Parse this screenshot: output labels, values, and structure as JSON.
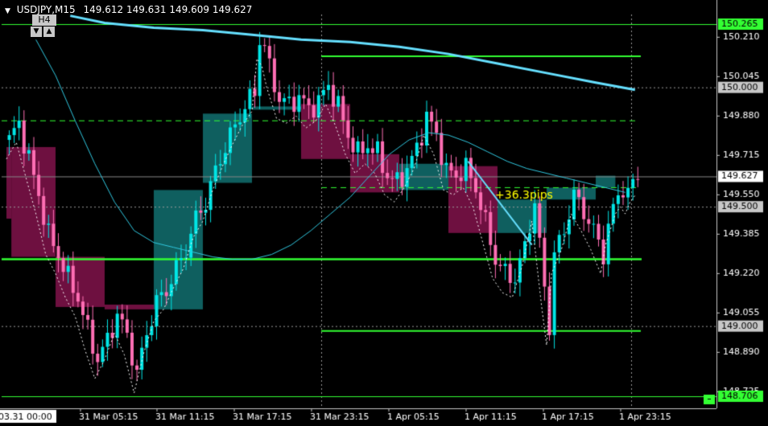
{
  "header": {
    "symbol": "USDJPY,M15",
    "quote": "149.612 149.631 149.609 149.627"
  },
  "timeframe_box": {
    "label": "H4",
    "down_icon": "▼",
    "up_icon": "▲"
  },
  "colors": {
    "background": "#000000",
    "bull_candle": "#00e6e6",
    "bear_candle": "#ff6eb4",
    "h4_bull_box": "#0f5f5f",
    "h4_bear_box": "#6e1040",
    "green_line": "#33ff33",
    "ma_slow": "#66e0ff",
    "ma_fast": "#30c8e0",
    "annotation": "#ffff00",
    "grid": "#c8c8c8"
  },
  "chart_data": {
    "type": "candlestick",
    "symbol": "USDJPY",
    "timeframe": "M15",
    "y_range": [
      148.706,
      150.265
    ],
    "y_ticks": [
      "150.210",
      "150.045",
      "149.880",
      "149.715",
      "149.550",
      "149.385",
      "149.220",
      "149.055",
      "148.890",
      "148.725"
    ],
    "price_labels": [
      {
        "text": "150.265",
        "value": 150.265,
        "style": "green"
      },
      {
        "text": "150.000",
        "value": 150.0,
        "style": "gray"
      },
      {
        "text": "149.627",
        "value": 149.627,
        "style": "white"
      },
      {
        "text": "149.500",
        "value": 149.5,
        "style": "gray"
      },
      {
        "text": "149.000",
        "value": 149.0,
        "style": "gray"
      },
      {
        "text": "148.706",
        "value": 148.706,
        "style": "green"
      }
    ],
    "x_labels": [
      "03.31 00:00",
      "31 Mar 05:15",
      "31 Mar 11:15",
      "31 Mar 17:15",
      "31 Mar 23:15",
      "1 Apr 05:15",
      "1 Apr 11:15",
      "1 Apr 17:15",
      "1 Apr 23:15"
    ],
    "x_label_highlighted": "03.31 00:00",
    "annotation": "+36.3pips",
    "horizontal_levels": {
      "long_green_lines": [
        150.265,
        149.28,
        148.706
      ],
      "partial_green_lines": [
        150.13,
        148.98
      ],
      "dashed_green_lines": [
        149.86,
        149.58
      ],
      "dotted_white_lines": [
        150.0,
        149.5,
        149.0
      ]
    },
    "h4_boxes": [
      {
        "from_bar": 0,
        "to_bar": 1,
        "open": 149.75,
        "close": 149.45,
        "dir": "bear"
      },
      {
        "from_bar": 1,
        "to_bar": 10,
        "open": 149.75,
        "close": 149.29,
        "dir": "bear"
      },
      {
        "from_bar": 10,
        "to_bar": 20,
        "open": 149.29,
        "close": 149.08,
        "dir": "bear"
      },
      {
        "from_bar": 20,
        "to_bar": 30,
        "open": 149.07,
        "close": 149.09,
        "dir": "bear"
      },
      {
        "from_bar": 30,
        "to_bar": 40,
        "open": 149.07,
        "close": 149.57,
        "dir": "bull"
      },
      {
        "from_bar": 40,
        "to_bar": 50,
        "open": 149.6,
        "close": 149.89,
        "dir": "bull"
      },
      {
        "from_bar": 50,
        "to_bar": 60,
        "open": 149.92,
        "close": 149.92,
        "dir": "bull"
      },
      {
        "from_bar": 60,
        "to_bar": 70,
        "open": 149.93,
        "close": 149.7,
        "dir": "bear"
      },
      {
        "from_bar": 70,
        "to_bar": 80,
        "open": 149.72,
        "close": 149.56,
        "dir": "bear"
      },
      {
        "from_bar": 80,
        "to_bar": 90,
        "open": 149.57,
        "close": 149.68,
        "dir": "bull"
      },
      {
        "from_bar": 90,
        "to_bar": 100,
        "open": 149.67,
        "close": 149.39,
        "dir": "bear"
      },
      {
        "from_bar": 100,
        "to_bar": 110,
        "open": 149.39,
        "close": 149.53,
        "dir": "bull"
      },
      {
        "from_bar": 110,
        "to_bar": 120,
        "open": 149.53,
        "close": 149.58,
        "dir": "bull"
      },
      {
        "from_bar": 120,
        "to_bar": 124,
        "open": 149.58,
        "close": 149.63,
        "dir": "bull"
      }
    ],
    "close_path": [
      [
        0,
        149.78
      ],
      [
        2,
        149.85
      ],
      [
        4,
        149.7
      ],
      [
        6,
        149.55
      ],
      [
        8,
        149.38
      ],
      [
        10,
        149.3
      ],
      [
        12,
        149.2
      ],
      [
        14,
        149.12
      ],
      [
        16,
        148.98
      ],
      [
        18,
        148.86
      ],
      [
        20,
        148.94
      ],
      [
        22,
        149.05
      ],
      [
        24,
        148.96
      ],
      [
        26,
        148.8
      ],
      [
        28,
        148.97
      ],
      [
        30,
        149.1
      ],
      [
        32,
        149.15
      ],
      [
        34,
        149.24
      ],
      [
        36,
        149.32
      ],
      [
        38,
        149.45
      ],
      [
        40,
        149.52
      ],
      [
        42,
        149.65
      ],
      [
        44,
        149.75
      ],
      [
        46,
        149.84
      ],
      [
        48,
        149.92
      ],
      [
        50,
        149.98
      ],
      [
        51,
        150.2
      ],
      [
        52,
        150.17
      ],
      [
        53,
        150.08
      ],
      [
        55,
        149.95
      ],
      [
        57,
        149.93
      ],
      [
        59,
        149.96
      ],
      [
        61,
        149.91
      ],
      [
        63,
        149.94
      ],
      [
        65,
        150.01
      ],
      [
        67,
        149.92
      ],
      [
        69,
        149.8
      ],
      [
        71,
        149.72
      ],
      [
        73,
        149.76
      ],
      [
        75,
        149.72
      ],
      [
        77,
        149.63
      ],
      [
        79,
        149.6
      ],
      [
        81,
        149.66
      ],
      [
        83,
        149.74
      ],
      [
        85,
        149.88
      ],
      [
        87,
        149.8
      ],
      [
        89,
        149.65
      ],
      [
        91,
        149.63
      ],
      [
        93,
        149.66
      ],
      [
        95,
        149.58
      ],
      [
        97,
        149.43
      ],
      [
        99,
        149.28
      ],
      [
        101,
        149.22
      ],
      [
        103,
        149.2
      ],
      [
        105,
        149.33
      ],
      [
        107,
        149.52
      ],
      [
        109,
        149.16
      ],
      [
        110,
        149.0
      ],
      [
        111,
        149.3
      ],
      [
        113,
        149.4
      ],
      [
        115,
        149.55
      ],
      [
        117,
        149.48
      ],
      [
        119,
        149.4
      ],
      [
        121,
        149.3
      ],
      [
        122,
        149.42
      ],
      [
        124,
        149.55
      ],
      [
        125,
        149.58
      ],
      [
        126,
        149.55
      ],
      [
        127,
        149.6
      ],
      [
        128,
        149.627
      ]
    ],
    "ma_slow_path": [
      [
        13,
        150.3
      ],
      [
        20,
        150.27
      ],
      [
        30,
        150.25
      ],
      [
        40,
        150.24
      ],
      [
        50,
        150.22
      ],
      [
        60,
        150.2
      ],
      [
        70,
        150.19
      ],
      [
        80,
        150.17
      ],
      [
        90,
        150.14
      ],
      [
        100,
        150.1
      ],
      [
        110,
        150.06
      ],
      [
        120,
        150.02
      ],
      [
        128,
        149.99
      ]
    ],
    "ma_fast_path": [
      [
        6,
        150.2
      ],
      [
        10,
        150.05
      ],
      [
        14,
        149.86
      ],
      [
        18,
        149.68
      ],
      [
        22,
        149.52
      ],
      [
        26,
        149.4
      ],
      [
        30,
        149.35
      ],
      [
        34,
        149.33
      ],
      [
        38,
        149.31
      ],
      [
        42,
        149.29
      ],
      [
        46,
        149.28
      ],
      [
        50,
        149.28
      ],
      [
        54,
        149.3
      ],
      [
        58,
        149.34
      ],
      [
        62,
        149.4
      ],
      [
        66,
        149.47
      ],
      [
        70,
        149.54
      ],
      [
        74,
        149.63
      ],
      [
        78,
        149.72
      ],
      [
        82,
        149.78
      ],
      [
        86,
        149.81
      ],
      [
        90,
        149.8
      ],
      [
        94,
        149.77
      ],
      [
        98,
        149.73
      ],
      [
        102,
        149.69
      ],
      [
        106,
        149.66
      ],
      [
        110,
        149.64
      ],
      [
        114,
        149.62
      ],
      [
        118,
        149.6
      ],
      [
        122,
        149.58
      ],
      [
        126,
        149.56
      ]
    ],
    "trend_segment": {
      "from": [
        94,
        149.69
      ],
      "to": [
        107,
        149.34
      ]
    }
  }
}
